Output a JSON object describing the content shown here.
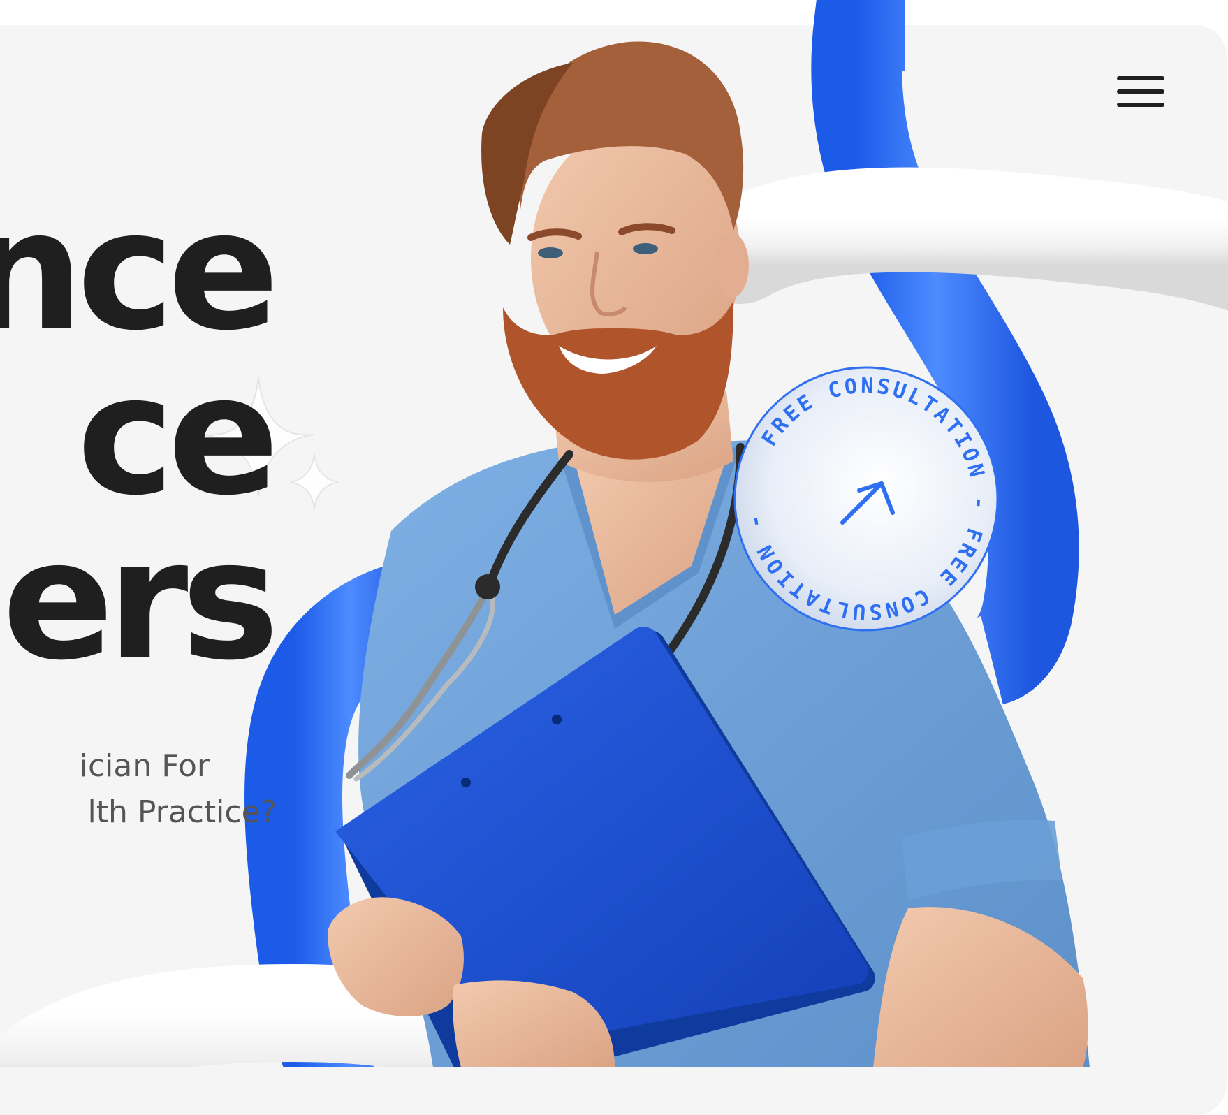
{
  "hero": {
    "headline_lines": [
      "nce",
      "ce",
      "ers"
    ],
    "subtext_lines": [
      "ician For",
      "lth Practice?"
    ]
  },
  "badge": {
    "ring_text": "FREE CONSULTATION - FREE CONSULTATION - "
  },
  "icons": {
    "menu": "hamburger-menu-icon",
    "badge_arrow": "arrow-up-left-icon",
    "sparkle": "sparkle-icon"
  },
  "colors": {
    "accent": "#2f6ff2",
    "headline": "#1f1f1f",
    "scrubs": "#6fa2d8",
    "clipboard": "#1f4fcf"
  }
}
